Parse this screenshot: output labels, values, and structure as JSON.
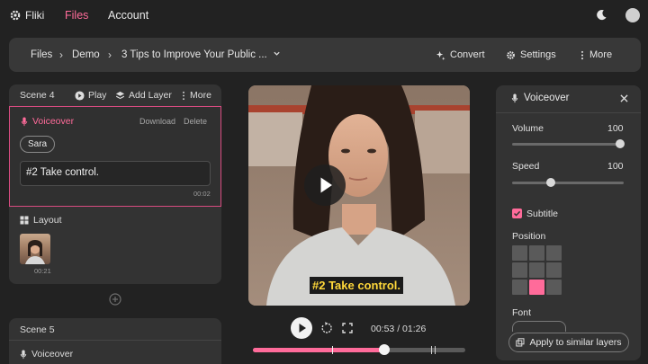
{
  "nav": {
    "logo": "Fliki",
    "files": "Files",
    "account": "Account"
  },
  "breadcrumb": {
    "files": "Files",
    "demo": "Demo",
    "title": "3 Tips to Improve Your Public ..."
  },
  "toolbar": {
    "convert": "Convert",
    "settings": "Settings",
    "more": "More"
  },
  "scene4": {
    "title": "Scene 4",
    "play": "Play",
    "add_layer": "Add Layer",
    "more": "More",
    "voiceover_label": "Voiceover",
    "download": "Download",
    "delete": "Delete",
    "voice": "Sara",
    "text": "#2 Take control.",
    "text_duration": "00:02",
    "layout_label": "Layout",
    "layout_duration": "00:21"
  },
  "scene5": {
    "title": "Scene 5",
    "voiceover_label": "Voiceover"
  },
  "player": {
    "subtitle": "#2 Take control.",
    "time": "00:53 / 01:26",
    "progress_fraction": 0.62
  },
  "panel": {
    "title": "Voiceover",
    "volume_label": "Volume",
    "volume_value": "100",
    "speed_label": "Speed",
    "speed_value": "100",
    "speed_fraction": 0.35,
    "subtitle_label": "Subtitle",
    "subtitle_checked": true,
    "position_label": "Position",
    "position_selected_cell": 7,
    "font_label": "Font",
    "apply_button": "Apply to similar layers"
  },
  "colors": {
    "accent": "#ff6b9a",
    "background": "#222222",
    "card": "#333333"
  }
}
